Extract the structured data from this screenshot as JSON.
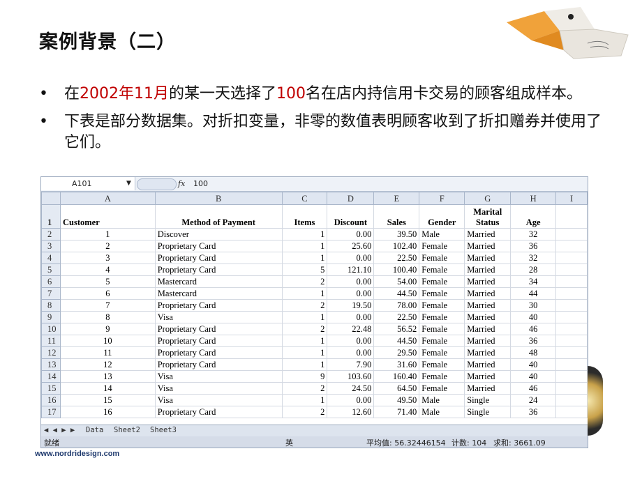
{
  "slide_title": "案例背景（二）",
  "bullets": [
    {
      "pre": "在",
      "r1": "2002年11月",
      "mid": "的某一天选择了",
      "r2": "100",
      "post": "名在店内持信用卡交易的顾客组成样本。"
    },
    {
      "text": "下表是部分数据集。对折扣变量，非零的数值表明顾客收到了折扣赠券并使用了它们。"
    }
  ],
  "spreadsheet": {
    "name_box": "A101",
    "fx_symbol": "fx",
    "formula_value": "100",
    "columns": [
      "A",
      "B",
      "C",
      "D",
      "E",
      "F",
      "G",
      "H",
      "I"
    ],
    "header_row": {
      "row": "1",
      "cells": [
        "Customer",
        "Method of Payment",
        "Items",
        "Discount",
        "Sales",
        "Gender",
        "Marital Status",
        "Age",
        ""
      ]
    },
    "rows": [
      [
        "2",
        "1",
        "Discover",
        "1",
        "0.00",
        "39.50",
        "Male",
        "Married",
        "32"
      ],
      [
        "3",
        "2",
        "Proprietary Card",
        "1",
        "25.60",
        "102.40",
        "Female",
        "Married",
        "36"
      ],
      [
        "4",
        "3",
        "Proprietary Card",
        "1",
        "0.00",
        "22.50",
        "Female",
        "Married",
        "32"
      ],
      [
        "5",
        "4",
        "Proprietary Card",
        "5",
        "121.10",
        "100.40",
        "Female",
        "Married",
        "28"
      ],
      [
        "6",
        "5",
        "Mastercard",
        "2",
        "0.00",
        "54.00",
        "Female",
        "Married",
        "34"
      ],
      [
        "7",
        "6",
        "Mastercard",
        "1",
        "0.00",
        "44.50",
        "Female",
        "Married",
        "44"
      ],
      [
        "8",
        "7",
        "Proprietary Card",
        "2",
        "19.50",
        "78.00",
        "Female",
        "Married",
        "30"
      ],
      [
        "9",
        "8",
        "Visa",
        "1",
        "0.00",
        "22.50",
        "Female",
        "Married",
        "40"
      ],
      [
        "10",
        "9",
        "Proprietary Card",
        "2",
        "22.48",
        "56.52",
        "Female",
        "Married",
        "46"
      ],
      [
        "11",
        "10",
        "Proprietary Card",
        "1",
        "0.00",
        "44.50",
        "Female",
        "Married",
        "36"
      ],
      [
        "12",
        "11",
        "Proprietary Card",
        "1",
        "0.00",
        "29.50",
        "Female",
        "Married",
        "48"
      ],
      [
        "13",
        "12",
        "Proprietary Card",
        "1",
        "7.90",
        "31.60",
        "Female",
        "Married",
        "40"
      ],
      [
        "14",
        "13",
        "Visa",
        "9",
        "103.60",
        "160.40",
        "Female",
        "Married",
        "40"
      ],
      [
        "15",
        "14",
        "Visa",
        "2",
        "24.50",
        "64.50",
        "Female",
        "Married",
        "46"
      ],
      [
        "16",
        "15",
        "Visa",
        "1",
        "0.00",
        "49.50",
        "Male",
        "Single",
        "24"
      ],
      [
        "17",
        "16",
        "Proprietary Card",
        "2",
        "12.60",
        "71.40",
        "Male",
        "Single",
        "36"
      ]
    ],
    "sheet_tabs": [
      "Data",
      "Sheet2",
      "Sheet3"
    ],
    "nav_arrows": "◀ ◀ ▶ ▶",
    "status": {
      "ready": "就绪",
      "ime": "英",
      "average": "平均值: 56.32446154",
      "count": "计数: 104",
      "sum": "求和: 3661.09"
    }
  },
  "footer_url": "www.nordridesign.com",
  "colors": {
    "accent_red": "#c00000",
    "grid_header": "#dfe6f1"
  }
}
